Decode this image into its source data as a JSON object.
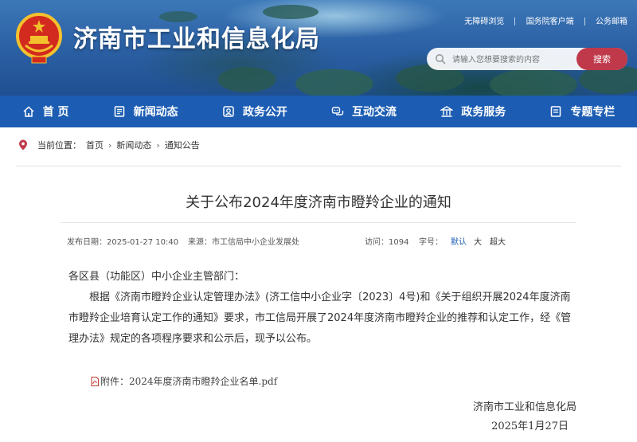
{
  "header": {
    "site_title": "济南市工业和信息化局",
    "top_links": [
      "无障碍浏览",
      "国务院客户端",
      "公务邮箱"
    ],
    "search": {
      "placeholder": "请输入您想要搜索的内容",
      "button_label": "搜索"
    }
  },
  "nav": {
    "items": [
      {
        "label": "首 页",
        "icon": "home-icon"
      },
      {
        "label": "新闻动态",
        "icon": "news-icon"
      },
      {
        "label": "政务公开",
        "icon": "policy-icon"
      },
      {
        "label": "互动交流",
        "icon": "chat-icon"
      },
      {
        "label": "政务服务",
        "icon": "building-icon"
      },
      {
        "label": "专题专栏",
        "icon": "column-icon"
      }
    ]
  },
  "breadcrumb": {
    "label": "当前位置：",
    "items": [
      "首页",
      "新闻动态",
      "通知公告"
    ],
    "separator": "›"
  },
  "article": {
    "title": "关于公布2024年度济南市瞪羚企业的通知",
    "meta": {
      "date": "发布日期：2025-01-27 10:40",
      "source": "来源：市工信局中小企业发展处",
      "views": "访问：1094",
      "font_size_label": "字号：",
      "font_sizes": [
        "默认",
        "大",
        "超大"
      ]
    },
    "salutation": "各区县（功能区）中小企业主管部门：",
    "paragraph": "根据《济南市瞪羚企业认定管理办法》(济工信中小企业字〔2023〕4号)和《关于组织开展2024年度济南市瞪羚企业培育认定工作的通知》要求，市工信局开展了2024年度济南市瞪羚企业的推荐和认定工作，经《管理办法》规定的各项程序要求和公示后，现予以公布。",
    "attachment": "附件：2024年度济南市瞪羚企业名单.pdf",
    "signature_org": "济南市工业和信息化局",
    "signature_date": "2025年1月27日"
  },
  "colors": {
    "nav_bg": "#1c5db3",
    "search_button": "#c0394b",
    "active_font_size": "#1c5db3"
  }
}
